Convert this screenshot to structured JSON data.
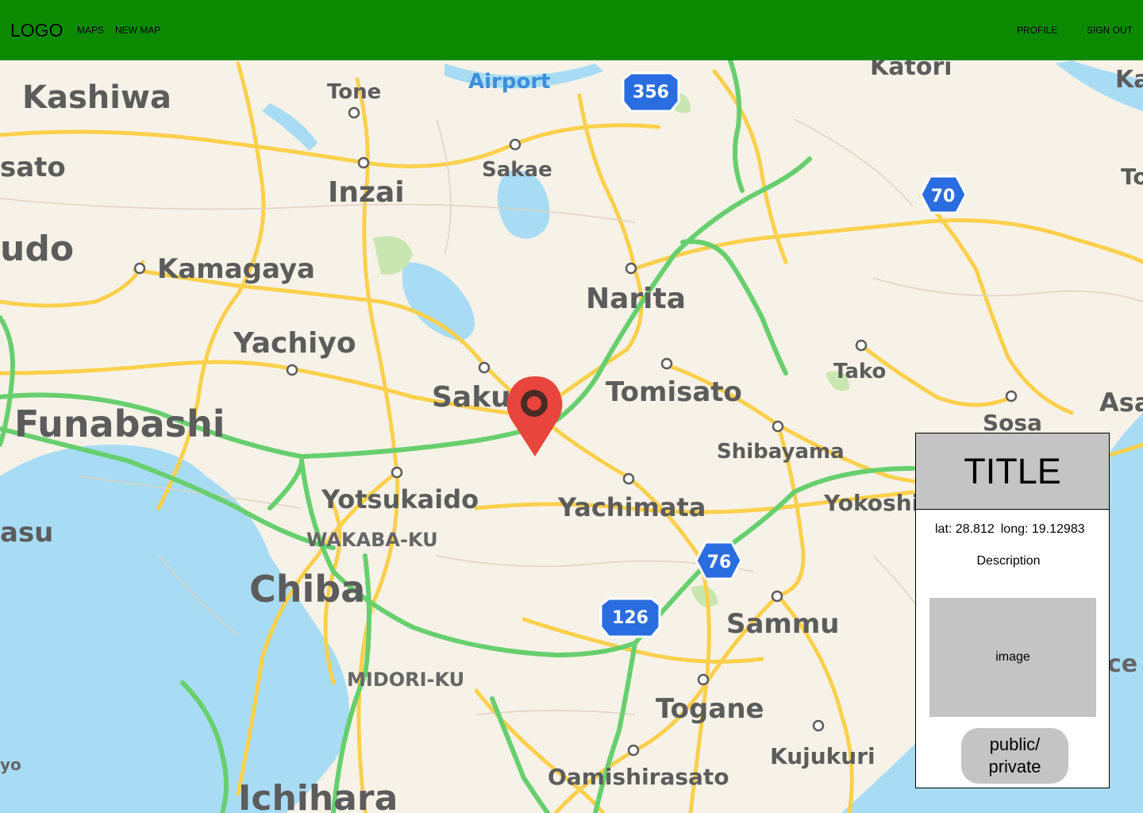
{
  "nav": {
    "logo": "LOGO",
    "maps": "MAPS",
    "new_map": "NEW MAP",
    "profile": "PROFILE",
    "sign_out": "SIGN OUT",
    "color": "#0b8a00"
  },
  "map": {
    "places": {
      "kashiwa": "Kashiwa",
      "tone": "Tone",
      "airport": "Airport",
      "katori": "Katori",
      "sakae": "Sakae",
      "inzai": "Inzai",
      "misato": "sato",
      "udo": "udo",
      "kamagaya": "Kamagaya",
      "narita": "Narita",
      "yachiyo": "Yachiyo",
      "sakura": "Sakura",
      "tomisato": "Tomisato",
      "tako": "Tako",
      "sosa": "Sosa",
      "asa": "Asa",
      "to": "To",
      "ka": "Ka",
      "funabashi": "Funabashi",
      "shibayama": "Shibayama",
      "yotsukaido": "Yotsukaido",
      "yachimata": "Yachimata",
      "yokoshi": "Yokoshi",
      "asu": "asu",
      "wakaba": "WAKABA-KU",
      "chiba": "Chiba",
      "sammu": "Sammu",
      "midori": "MIDORI-KU",
      "togane": "Togane",
      "kujukuri": "Kujukuri",
      "oamishirasato": "Oamishirasato",
      "ichihara": "Ichihara",
      "ce": "ce",
      "yo": "yo"
    },
    "shields": {
      "r356": "356",
      "r70": "70",
      "r76": "76",
      "r126": "126"
    },
    "colors": {
      "land": "#f7f2e8",
      "water": "#a8dcf5",
      "road": "#fcd04c",
      "highway": "#67cf6e",
      "pin": "#e8453c",
      "shield": "#2a6de0"
    }
  },
  "card": {
    "title": "TITLE",
    "lat": "lat: 28.812",
    "long": "long: 19.12983",
    "description": "Description",
    "image": "image",
    "toggle": "public/\nprivate"
  }
}
